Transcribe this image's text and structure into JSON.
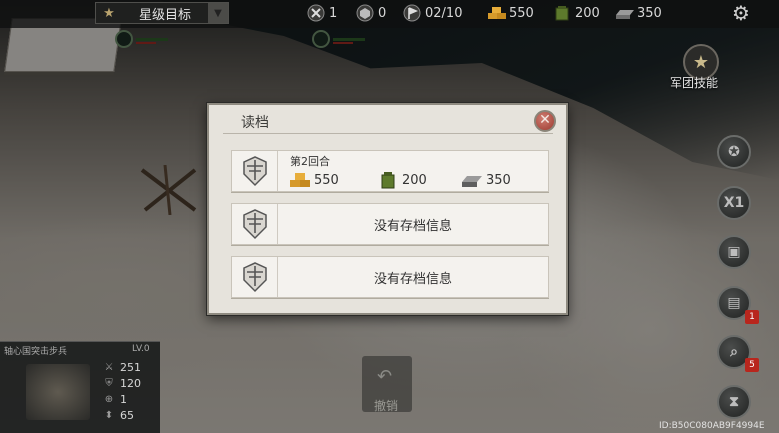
{
  "topbar": {
    "goal_label": "星级目标",
    "stats": [
      {
        "icon": "crossed-swords-icon",
        "value": "1"
      },
      {
        "icon": "cube-icon",
        "value": "0"
      },
      {
        "icon": "flag-icon",
        "value": "02/10"
      },
      {
        "icon": "gold-bars-icon",
        "value": "550"
      },
      {
        "icon": "ammo-box-icon",
        "value": "200"
      },
      {
        "icon": "steel-ingot-icon",
        "value": "350"
      }
    ]
  },
  "right_panel": {
    "skill_label": "军团技能",
    "speed_label": "X1",
    "badges": [
      "1",
      "5"
    ]
  },
  "unit_info": {
    "name": "轴心国突击步兵",
    "level": "LV.0",
    "stats": [
      "251",
      "120",
      "1",
      "65"
    ]
  },
  "undo_label": "撤销",
  "device_id": "ID:B50C080AB9F4994E",
  "dialog": {
    "title": "读档",
    "slots": [
      {
        "turn": "第2回合",
        "gold": "550",
        "ammo": "200",
        "steel": "350"
      },
      {
        "empty_text": "没有存档信息"
      },
      {
        "empty_text": "没有存档信息"
      }
    ]
  },
  "colors": {
    "accent": "#b8261d",
    "dialog_bg": "#e6e3dc"
  }
}
